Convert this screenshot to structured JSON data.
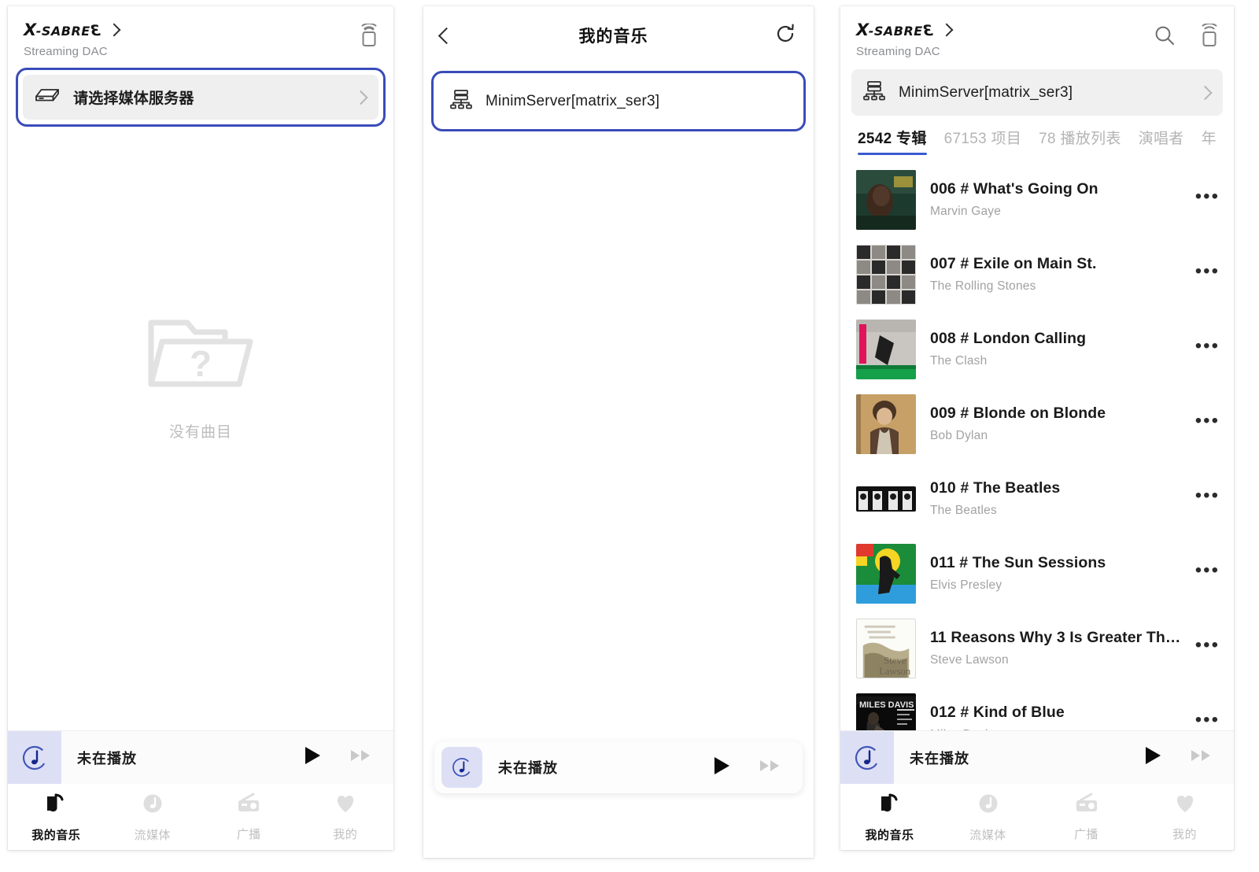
{
  "device": {
    "logo_x": "X",
    "logo_sabre": "-SABRE",
    "logo_3": "3",
    "subtitle": "Streaming DAC"
  },
  "panel1": {
    "server_row_label": "请选择媒体服务器",
    "empty_label": "没有曲目",
    "player": {
      "title": "未在播放"
    },
    "tabbar": [
      {
        "label": "我的音乐",
        "icon": "my-music-icon",
        "active": true
      },
      {
        "label": "流媒体",
        "icon": "streaming-icon",
        "active": false
      },
      {
        "label": "广播",
        "icon": "radio-icon",
        "active": false
      },
      {
        "label": "我的",
        "icon": "heart-icon",
        "active": false
      }
    ]
  },
  "panel2": {
    "nav_title": "我的音乐",
    "server_row_label": "MinimServer[matrix_ser3]",
    "player": {
      "title": "未在播放"
    }
  },
  "panel3": {
    "server_row_label": "MinimServer[matrix_ser3]",
    "tabs": [
      {
        "label": "2542 专辑",
        "active": true
      },
      {
        "label": "67153 项目",
        "active": false
      },
      {
        "label": "78 播放列表",
        "active": false
      },
      {
        "label": "演唱者",
        "active": false
      },
      {
        "label": "年",
        "active": false
      }
    ],
    "albums": [
      {
        "title": "006 # What's Going On",
        "artist": "Marvin Gaye",
        "art": "marvin"
      },
      {
        "title": "007 # Exile on Main St.",
        "artist": "The Rolling Stones",
        "art": "exile"
      },
      {
        "title": "008 # London Calling",
        "artist": "The Clash",
        "art": "london"
      },
      {
        "title": "009 # Blonde on Blonde",
        "artist": "Bob Dylan",
        "art": "dylan"
      },
      {
        "title": "010 # The Beatles",
        "artist": "The Beatles",
        "art": "beatles"
      },
      {
        "title": "011 # The Sun Sessions",
        "artist": "Elvis Presley",
        "art": "elvis"
      },
      {
        "title": "11 Reasons Why 3 Is Greater Tha…",
        "artist": "Steve Lawson",
        "art": "lawson"
      },
      {
        "title": "012 # Kind of Blue",
        "artist": "Miles Davis",
        "art": "miles"
      }
    ],
    "menu_dots": "•••",
    "player": {
      "title": "未在播放"
    },
    "tabbar": [
      {
        "label": "我的音乐",
        "icon": "my-music-icon",
        "active": true
      },
      {
        "label": "流媒体",
        "icon": "streaming-icon",
        "active": false
      },
      {
        "label": "广播",
        "icon": "radio-icon",
        "active": false
      },
      {
        "label": "我的",
        "icon": "heart-icon",
        "active": false
      }
    ]
  },
  "colors": {
    "highlight_border": "#3a4cb8",
    "tab_underline": "#3b5bd0",
    "player_thumb_bg": "#dde0f5"
  }
}
